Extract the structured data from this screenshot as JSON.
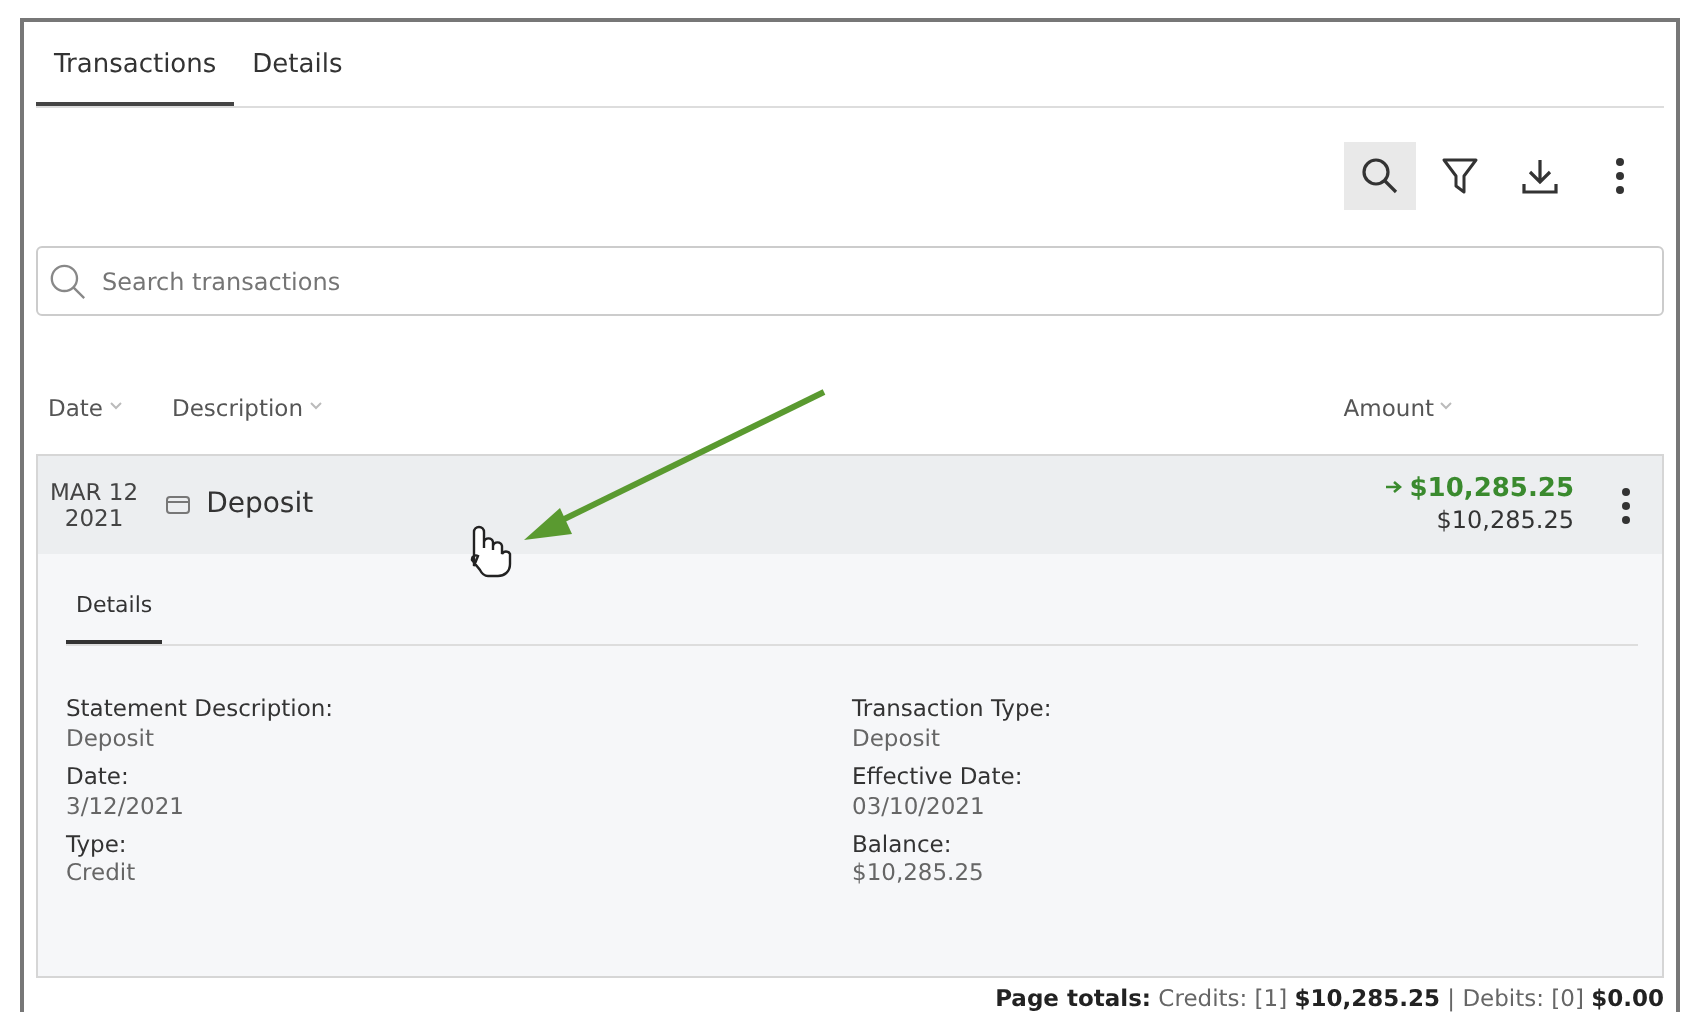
{
  "tabs": [
    {
      "label": "Transactions",
      "selected": true
    },
    {
      "label": "Details",
      "selected": false
    }
  ],
  "toolbar": [
    {
      "kind": "search",
      "selected": true
    },
    {
      "kind": "filter",
      "selected": false
    },
    {
      "kind": "download",
      "selected": false
    },
    {
      "kind": "more",
      "selected": false
    }
  ],
  "search": {
    "placeholder": "Search transactions"
  },
  "table": {
    "columns": [
      "Date",
      "Description",
      "Amount"
    ],
    "rows": [
      {
        "date": "MAR 12",
        "year": "2021",
        "description": "Deposit",
        "amount": "$10,285.25",
        "balance": "$10,285.25",
        "expanded": true,
        "detail_tabs": [
          {
            "label": "Details",
            "selected": true
          }
        ],
        "fields": [
          {
            "label": "Statement Description:",
            "value": "Deposit"
          },
          {
            "label": "Transaction Type:",
            "value": "Deposit"
          },
          {
            "label": "Date:",
            "value": "3/12/2021"
          },
          {
            "label": "Effective Date:",
            "value": "03/10/2021"
          },
          {
            "label": "Type:",
            "value": "Credit"
          },
          {
            "label": "Balance:",
            "value": "$10,285.25"
          }
        ]
      }
    ]
  },
  "page_totals": "**Page totals:** Credits: [1] **$10,285.25** | Debits: [0] **$0.00**"
}
